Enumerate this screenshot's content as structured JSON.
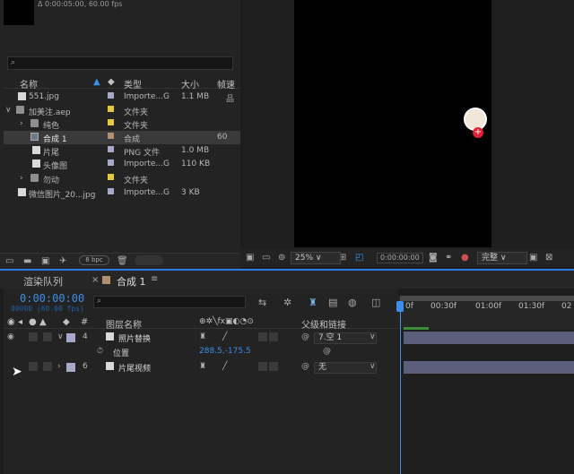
{
  "project": {
    "thumbnail_info": "Δ 0:00:05:00, 60.00 fps",
    "search_placeholder": "",
    "columns": {
      "name": "名称",
      "type": "类型",
      "size": "大小",
      "extra": "帧速"
    },
    "items": [
      {
        "name": "551.jpg",
        "type": "Importe...G",
        "size": "1.1 MB",
        "swatch": "#a8a8c8",
        "kind": "file",
        "indent": 0
      },
      {
        "name": "加美注.aep",
        "type": "文件夹",
        "size": "",
        "swatch": "#e6c83c",
        "kind": "folder",
        "indent": 0,
        "expanded": true
      },
      {
        "name": "纯色",
        "type": "文件夹",
        "size": "",
        "swatch": "#e6c83c",
        "kind": "folder",
        "indent": 1
      },
      {
        "name": "合成 1",
        "type": "合成",
        "size": "",
        "fps": "60",
        "swatch": "#b09070",
        "kind": "comp",
        "indent": 1,
        "selected": true
      },
      {
        "name": "片尾",
        "type": "PNG 文件",
        "size": "1.0 MB",
        "swatch": "#a8a8c8",
        "kind": "file",
        "indent": 1
      },
      {
        "name": "头像图",
        "type": "Importe...G",
        "size": "110 KB",
        "swatch": "#a8a8c8",
        "kind": "file",
        "indent": 1
      },
      {
        "name": "勿动",
        "type": "文件夹",
        "size": "",
        "swatch": "#e6c83c",
        "kind": "folder",
        "indent": 1
      },
      {
        "name": "微信图片_20...jpg",
        "type": "Importe...G",
        "size": "3 KB",
        "swatch": "#a8a8c8",
        "kind": "file",
        "indent": 0
      }
    ],
    "bpc": "8 bpc"
  },
  "viewer": {
    "zoom": "25%",
    "timecode": "0:00:00:00",
    "quality": "完整"
  },
  "timeline": {
    "tabs": {
      "render_queue": "渲染队列",
      "comp": "合成 1"
    },
    "current_time": "0:00:00:00",
    "frames": "00000 (60.00 fps)",
    "columns": {
      "layer_name": "图层名称",
      "parent": "父级和链接",
      "hash": "#"
    },
    "ruler": [
      "0f",
      "00:30f",
      "01:00f",
      "01:30f",
      "02"
    ],
    "layers": [
      {
        "index": "4",
        "name": "照片替换",
        "swatch": "#a8a8c8",
        "parent": "7.空 1",
        "expanded": true
      },
      {
        "property": "位置",
        "value": "288.5,-175.5"
      },
      {
        "index": "6",
        "name": "片尾视频",
        "swatch": "#a8a8c8",
        "parent": "无",
        "expanded": false
      }
    ],
    "accent": "#3d8ee8"
  }
}
